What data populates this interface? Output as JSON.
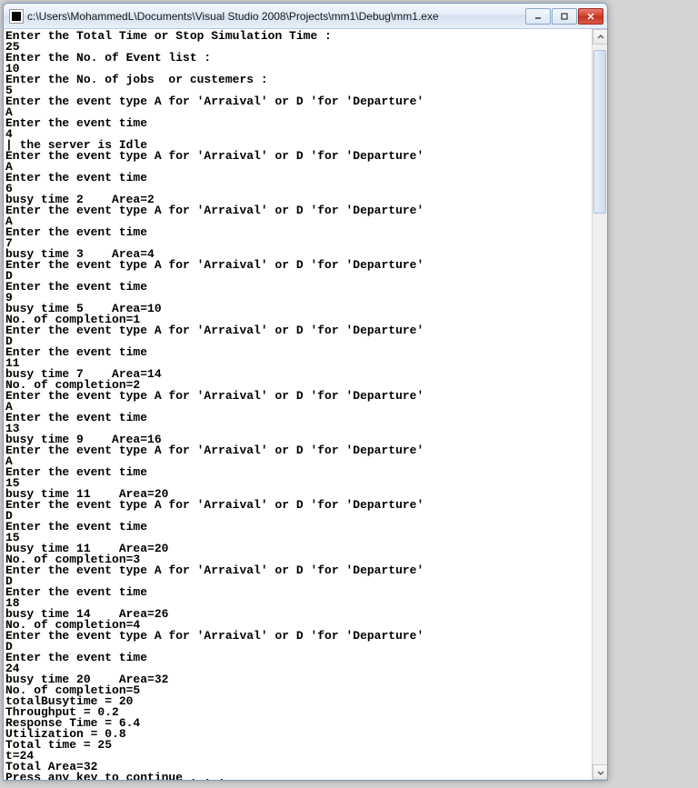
{
  "window": {
    "title": "c:\\Users\\MohammedL\\Documents\\Visual Studio 2008\\Projects\\mm1\\Debug\\mm1.exe"
  },
  "console": {
    "lines": [
      "Enter the Total Time or Stop Simulation Time :",
      "25",
      "Enter the No. of Event list :",
      "10",
      "Enter the No. of jobs  or custemers :",
      "5",
      "Enter the event type A for 'Arraival' or D 'for 'Departure'",
      "A",
      "Enter the event time",
      "4",
      "| the server is Idle",
      "Enter the event type A for 'Arraival' or D 'for 'Departure'",
      "A",
      "Enter the event time",
      "6",
      "busy time 2    Area=2",
      "Enter the event type A for 'Arraival' or D 'for 'Departure'",
      "A",
      "Enter the event time",
      "7",
      "busy time 3    Area=4",
      "Enter the event type A for 'Arraival' or D 'for 'Departure'",
      "D",
      "Enter the event time",
      "9",
      "busy time 5    Area=10",
      "No. of completion=1",
      "Enter the event type A for 'Arraival' or D 'for 'Departure'",
      "D",
      "Enter the event time",
      "11",
      "busy time 7    Area=14",
      "No. of completion=2",
      "Enter the event type A for 'Arraival' or D 'for 'Departure'",
      "A",
      "Enter the event time",
      "13",
      "busy time 9    Area=16",
      "Enter the event type A for 'Arraival' or D 'for 'Departure'",
      "A",
      "Enter the event time",
      "15",
      "busy time 11    Area=20",
      "Enter the event type A for 'Arraival' or D 'for 'Departure'",
      "D",
      "Enter the event time",
      "15",
      "busy time 11    Area=20",
      "No. of completion=3",
      "Enter the event type A for 'Arraival' or D 'for 'Departure'",
      "D",
      "Enter the event time",
      "18",
      "busy time 14    Area=26",
      "No. of completion=4",
      "Enter the event type A for 'Arraival' or D 'for 'Departure'",
      "D",
      "Enter the event time",
      "24",
      "busy time 20    Area=32",
      "No. of completion=5",
      "totalBusytime = 20",
      "Throughput = 0.2",
      "Response Time = 6.4",
      "Utilization = 0.8",
      "Total time = 25",
      "t=24",
      "Total Area=32",
      "Press any key to continue . . ."
    ]
  }
}
